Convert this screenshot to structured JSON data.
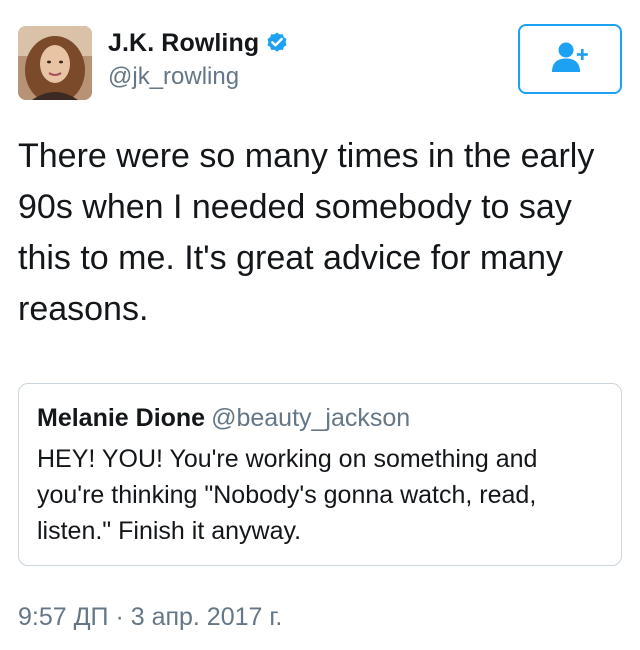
{
  "author": {
    "display_name": "J.K. Rowling",
    "handle": "@jk_rowling",
    "verified": true,
    "avatar_icon": "profile-photo"
  },
  "follow_button": {
    "icon": "follow-person-plus-icon",
    "accent_color": "#1da1f2"
  },
  "tweet": {
    "text": "There were so many times in the early 90s when I needed somebody to say this to me. It's great advice for many reasons."
  },
  "quoted_tweet": {
    "display_name": "Melanie Dione",
    "handle": "@beauty_jackson",
    "text": "HEY! YOU! You're working on something and you're thinking \"Nobody's gonna watch, read, listen.\" Finish it anyway."
  },
  "meta": {
    "timestamp": "9:57 ДП · 3 апр. 2017 г."
  },
  "colors": {
    "text_primary": "#14171a",
    "text_secondary": "#657786",
    "border": "#ccd6dd",
    "accent": "#1da1f2"
  }
}
